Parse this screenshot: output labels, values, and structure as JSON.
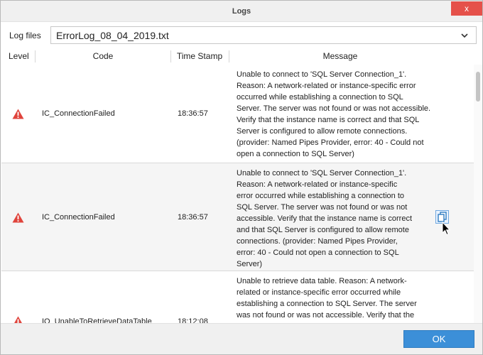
{
  "window": {
    "title": "Logs",
    "close_label": "x"
  },
  "logfiles": {
    "label": "Log files",
    "selected": "ErrorLog_08_04_2019.txt"
  },
  "columns": {
    "level": "Level",
    "code": "Code",
    "timestamp": "Time Stamp",
    "message": "Message"
  },
  "rows": [
    {
      "level_icon": "warning-icon",
      "code": "IC_ConnectionFailed",
      "time": "18:36:57",
      "message_lines": [
        "Unable to connect to 'SQL Server Connection_1'.",
        "Reason: A network-related or instance-specific error",
        "occurred while establishing a connection to SQL",
        "Server. The server was not found or was not accessible.",
        "Verify that the instance name is correct and that SQL",
        "Server is configured to allow remote connections.",
        "(provider: Named Pipes Provider, error: 40 - Could not",
        "open a connection to SQL Server)"
      ]
    },
    {
      "level_icon": "warning-icon",
      "code": "IC_ConnectionFailed",
      "time": "18:36:57",
      "message_lines": [
        "Unable to connect to 'SQL Server Connection_1'.",
        "Reason: A network-related or instance-specific",
        "error occurred while establishing a connection to",
        "SQL Server. The server was not found or was not",
        "accessible. Verify that the instance name is correct",
        "and that SQL Server is configured to allow remote",
        "connections. (provider: Named Pipes Provider,",
        "error: 40 - Could not open a connection to SQL",
        "Server)"
      ]
    },
    {
      "level_icon": "warning-icon",
      "code": "IO_UnableToRetrieveDataTable",
      "time": "18:12:08",
      "message_lines": [
        "Unable to retrieve data table. Reason: A network-",
        "related or instance-specific error occurred while",
        "establishing a connection to SQL Server. The server",
        "was not found or was not accessible. Verify that the"
      ]
    }
  ],
  "icons": {
    "copy": "copy-icon",
    "dropdown": "chevron-down-icon",
    "cursor": "cursor-icon"
  },
  "colors": {
    "warning": "#e0443c",
    "accent": "#3c8fd8",
    "close": "#e5514a"
  },
  "footer": {
    "ok_label": "OK"
  }
}
